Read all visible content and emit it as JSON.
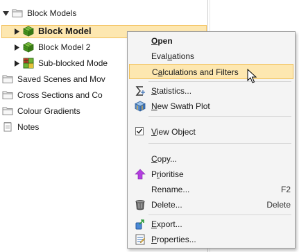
{
  "tree": {
    "items": [
      {
        "label": "Block Models",
        "expanded": true
      },
      {
        "label": "Block Model",
        "selected": true
      },
      {
        "label": "Block Model 2"
      },
      {
        "label": "Sub-blocked Mode"
      },
      {
        "label": "Saved Scenes and Mov"
      },
      {
        "label": "Cross Sections and Co"
      },
      {
        "label": "Colour Gradients"
      },
      {
        "label": "Notes"
      }
    ]
  },
  "menu": {
    "open": {
      "pre": "",
      "u": "O",
      "post": "pen"
    },
    "evaluations": {
      "pre": "Eval",
      "u": "u",
      "post": "ations"
    },
    "calculations": {
      "pre": "C",
      "u": "a",
      "post": "lculations and Filters"
    },
    "statistics": {
      "pre": "",
      "u": "S",
      "post": "tatistics..."
    },
    "swath": {
      "pre": "",
      "u": "N",
      "post": "ew Swath Plot"
    },
    "view_object": {
      "pre": "",
      "u": "V",
      "post": "iew Object"
    },
    "copy": {
      "pre": "",
      "u": "C",
      "post": "opy..."
    },
    "prioritise": {
      "pre": "P",
      "u": "r",
      "post": "ioritise"
    },
    "rename": {
      "label": "Rename...",
      "shortcut": "F2"
    },
    "delete": {
      "label": "Delete...",
      "shortcut": "Delete"
    },
    "export": {
      "pre": "",
      "u": "E",
      "post": "xport..."
    },
    "properties": {
      "pre": "",
      "u": "P",
      "post": "roperties..."
    }
  },
  "colors": {
    "highlight": "#fde7b0",
    "highlight_border": "#f0bf58",
    "menu_bg": "#f4f4f4"
  },
  "icons": [
    "folder-icon",
    "cube-icon",
    "grid-cube-icon",
    "notes-icon",
    "sigma-icon",
    "swath-plot-icon",
    "up-arrow-icon",
    "bin-icon",
    "export-icon",
    "properties-icon"
  ]
}
